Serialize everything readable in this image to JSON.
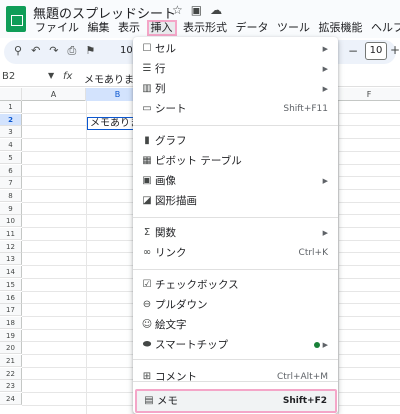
{
  "app": {
    "doc_title": "無題のスプレッドシート",
    "icons": [
      "star-icon",
      "move-folder-icon",
      "cloud-status-icon"
    ]
  },
  "menubar": {
    "items": [
      "ファイル",
      "編集",
      "表示",
      "挿入",
      "表示形式",
      "データ",
      "ツール",
      "拡張機能",
      "ヘルプ"
    ],
    "active": "挿入"
  },
  "toolbar": {
    "icons": [
      "search-icon",
      "undo-icon",
      "redo-icon",
      "print-icon",
      "paint-format-icon"
    ],
    "zoom": "10",
    "font_size": "10",
    "minus": "−",
    "plus": "+"
  },
  "formula_bar": {
    "name_box": "B2",
    "fx": "fx",
    "value": "メモあります"
  },
  "grid": {
    "columns": [
      "A",
      "B",
      "F"
    ],
    "selected_column": "B",
    "rows": [
      "1",
      "2",
      "3",
      "4",
      "5",
      "6",
      "7",
      "8",
      "9",
      "10",
      "11",
      "12",
      "13",
      "14",
      "15",
      "16",
      "17",
      "18",
      "19",
      "20",
      "21",
      "22",
      "23",
      "24"
    ],
    "selected_row": "2",
    "active_cell": "B2",
    "active_cell_value": "メモありま"
  },
  "insert_menu": {
    "items": [
      {
        "icon": "cell-icon",
        "label": "セル",
        "shortcut": "",
        "submenu": true
      },
      {
        "icon": "row-icon",
        "label": "行",
        "shortcut": "",
        "submenu": true
      },
      {
        "icon": "column-icon",
        "label": "列",
        "shortcut": "",
        "submenu": true
      },
      {
        "icon": "sheet-icon",
        "label": "シート",
        "shortcut": "Shift+F11",
        "submenu": false
      },
      {
        "icon": "chart-icon",
        "label": "グラフ",
        "shortcut": "",
        "submenu": false
      },
      {
        "icon": "pivot-table-icon",
        "label": "ピボット テーブル",
        "shortcut": "",
        "submenu": false
      },
      {
        "icon": "image-icon",
        "label": "画像",
        "shortcut": "",
        "submenu": true
      },
      {
        "icon": "drawing-icon",
        "label": "図形描画",
        "shortcut": "",
        "submenu": false
      },
      {
        "icon": "function-icon",
        "label": "関数",
        "shortcut": "",
        "submenu": true
      },
      {
        "icon": "link-icon",
        "label": "リンク",
        "shortcut": "Ctrl+K",
        "submenu": false
      },
      {
        "icon": "checkbox-icon",
        "label": "チェックボックス",
        "shortcut": "",
        "submenu": false
      },
      {
        "icon": "dropdown-icon",
        "label": "プルダウン",
        "shortcut": "",
        "submenu": false
      },
      {
        "icon": "emoji-icon",
        "label": "絵文字",
        "shortcut": "",
        "submenu": false
      },
      {
        "icon": "smart-chip-icon",
        "label": "スマートチップ",
        "shortcut": "",
        "submenu": true
      },
      {
        "icon": "comment-icon",
        "label": "コメント",
        "shortcut": "Ctrl+Alt+M",
        "submenu": false
      },
      {
        "icon": "note-icon",
        "label": "メモ",
        "shortcut": "Shift+F2",
        "submenu": false
      }
    ],
    "highlighted": "メモ"
  },
  "colors": {
    "accent": "#0b57d0",
    "highlight_border": "#f4a6c8",
    "sheets_green": "#0f9d58",
    "new_badge": "#188038"
  }
}
